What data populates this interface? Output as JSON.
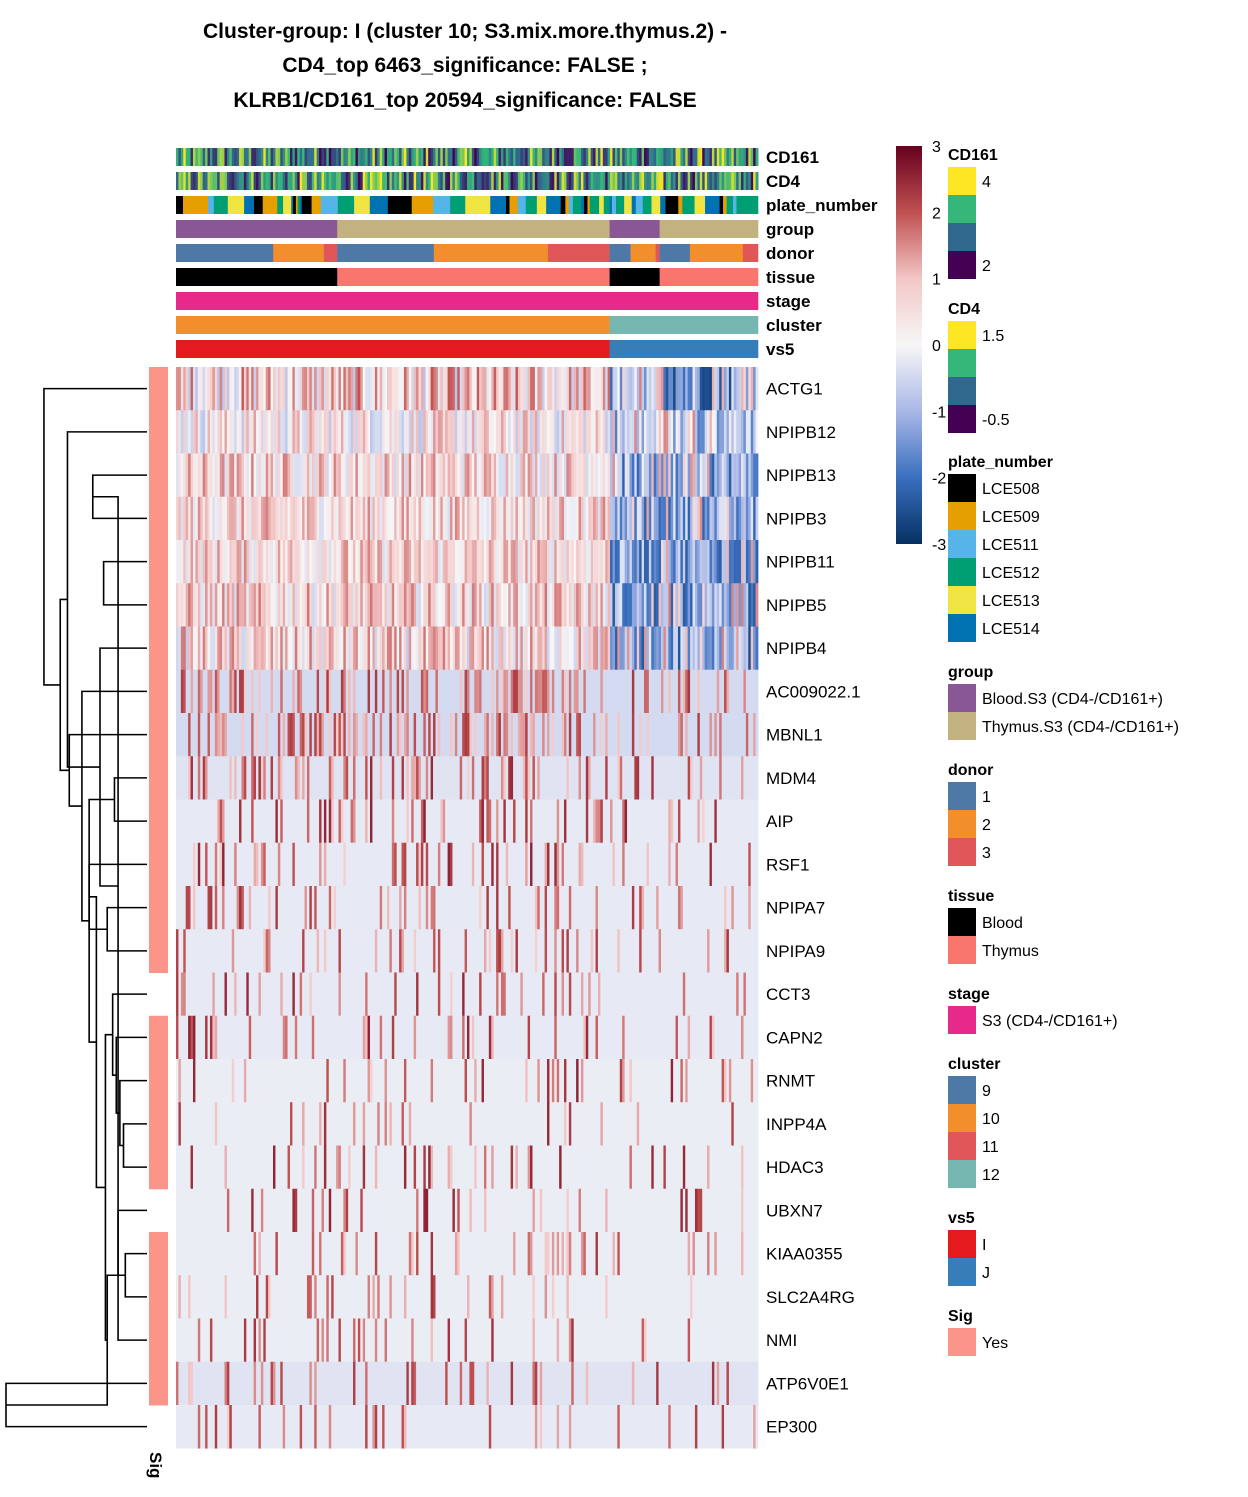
{
  "chart_data": {
    "type": "heatmap",
    "title": [
      "Cluster-group: I (cluster 10; S3.mix.more.thymus.2) -",
      "CD4_top 6463_significance: FALSE ;",
      "KLRB1/CD161_top 20594_significance: FALSE"
    ],
    "color_scale": {
      "range": [
        -3,
        3
      ],
      "ticks": [
        3,
        2,
        1,
        0,
        -1,
        -2,
        -3
      ],
      "tick_labels": [
        "3",
        "2",
        "1",
        "0",
        "-1",
        "-2",
        "-3"
      ],
      "stops": [
        {
          "value": -3,
          "color": "#053061"
        },
        {
          "value": -2,
          "color": "#3a6fbf"
        },
        {
          "value": -1,
          "color": "#a9b7e6"
        },
        {
          "value": 0,
          "color": "#f7f7f7"
        },
        {
          "value": 1,
          "color": "#f3c6c6"
        },
        {
          "value": 2,
          "color": "#c05050"
        },
        {
          "value": 3,
          "color": "#67001f"
        }
      ]
    },
    "n_columns": 240,
    "column_split_fraction": 0.745,
    "column_annotations": [
      {
        "name": "CD161",
        "kind": "continuous",
        "palette": [
          "#440154",
          "#31688e",
          "#35b779",
          "#fde725"
        ],
        "range": [
          2,
          4
        ]
      },
      {
        "name": "CD4",
        "kind": "continuous",
        "palette": [
          "#440154",
          "#31688e",
          "#35b779",
          "#fde725"
        ],
        "range": [
          -0.5,
          1.5
        ]
      },
      {
        "name": "plate_number",
        "kind": "discrete",
        "segments": [
          [
            "LCE508",
            0.0,
            0.012
          ],
          [
            "LCE509",
            0.012,
            0.055
          ],
          [
            "LCE511",
            0.055,
            0.065
          ],
          [
            "LCE512",
            0.065,
            0.089
          ],
          [
            "LCE513",
            0.089,
            0.117
          ],
          [
            "LCE514",
            0.117,
            0.134
          ],
          [
            "LCE508",
            0.134,
            0.149
          ],
          [
            "LCE509",
            0.149,
            0.174
          ],
          [
            "LCE512",
            0.174,
            0.184
          ],
          [
            "LCE513",
            0.184,
            0.198
          ],
          [
            "LCE514",
            0.198,
            0.201
          ],
          [
            "LCE508",
            0.201,
            0.206
          ],
          [
            "LCE509",
            0.206,
            0.209
          ],
          [
            "LCE512",
            0.209,
            0.213
          ],
          [
            "LCE514",
            0.213,
            0.216
          ],
          [
            "LCE508",
            0.216,
            0.233
          ],
          [
            "LCE509",
            0.233,
            0.249
          ],
          [
            "LCE511",
            0.249,
            0.278
          ],
          [
            "LCE512",
            0.278,
            0.306
          ],
          [
            "LCE513",
            0.306,
            0.333
          ],
          [
            "LCE514",
            0.333,
            0.364
          ],
          [
            "LCE508",
            0.364,
            0.405
          ],
          [
            "LCE509",
            0.405,
            0.442
          ],
          [
            "LCE511",
            0.442,
            0.471
          ],
          [
            "LCE512",
            0.471,
            0.497
          ],
          [
            "LCE513",
            0.497,
            0.54
          ],
          [
            "LCE514",
            0.54,
            0.567
          ],
          [
            "LCE508",
            0.567,
            0.573
          ],
          [
            "LCE509",
            0.573,
            0.587
          ],
          [
            "LCE511",
            0.587,
            0.601
          ],
          [
            "LCE512",
            0.601,
            0.62
          ],
          [
            "LCE513",
            0.62,
            0.636
          ],
          [
            "LCE514",
            0.636,
            0.661
          ],
          [
            "LCE508",
            0.661,
            0.669
          ],
          [
            "LCE509",
            0.669,
            0.675
          ],
          [
            "LCE511",
            0.675,
            0.682
          ],
          [
            "LCE512",
            0.682,
            0.696
          ],
          [
            "LCE514",
            0.696,
            0.701
          ],
          [
            "LCE508",
            0.701,
            0.707
          ],
          [
            "LCE509",
            0.707,
            0.711
          ],
          [
            "LCE512",
            0.711,
            0.727
          ],
          [
            "LCE513",
            0.727,
            0.735
          ],
          [
            "LCE512",
            0.735,
            0.745
          ],
          [
            "LCE514",
            0.745,
            0.749
          ],
          [
            "LCE511",
            0.749,
            0.756
          ],
          [
            "LCE512",
            0.756,
            0.77
          ],
          [
            "LCE513",
            0.77,
            0.783
          ],
          [
            "LCE514",
            0.783,
            0.79
          ],
          [
            "LCE511",
            0.79,
            0.802
          ],
          [
            "LCE512",
            0.802,
            0.817
          ],
          [
            "LCE513",
            0.817,
            0.832
          ],
          [
            "LCE514",
            0.832,
            0.841
          ],
          [
            "LCE508",
            0.841,
            0.863
          ],
          [
            "LCE509",
            0.863,
            0.87
          ],
          [
            "LCE512",
            0.87,
            0.891
          ],
          [
            "LCE513",
            0.891,
            0.909
          ],
          [
            "LCE514",
            0.909,
            0.934
          ],
          [
            "LCE508",
            0.934,
            0.94
          ],
          [
            "LCE509",
            0.94,
            0.946
          ],
          [
            "LCE512",
            0.946,
            0.957
          ],
          [
            "LCE511",
            0.957,
            0.963
          ],
          [
            "LCE512",
            0.963,
            1.0
          ]
        ]
      },
      {
        "name": "group",
        "kind": "discrete",
        "segments": [
          [
            "Blood.S3 (CD4-/CD161+)",
            0.0,
            0.277
          ],
          [
            "Thymus.S3 (CD4-/CD161+)",
            0.277,
            0.745
          ],
          [
            "Blood.S3 (CD4-/CD161+)",
            0.745,
            0.831
          ],
          [
            "Thymus.S3 (CD4-/CD161+)",
            0.831,
            1.0
          ]
        ]
      },
      {
        "name": "donor",
        "kind": "discrete",
        "segments": [
          [
            "1",
            0.0,
            0.167
          ],
          [
            "2",
            0.167,
            0.254
          ],
          [
            "3",
            0.254,
            0.277
          ],
          [
            "1",
            0.277,
            0.443
          ],
          [
            "2",
            0.443,
            0.639
          ],
          [
            "3",
            0.639,
            0.745
          ],
          [
            "1",
            0.745,
            0.781
          ],
          [
            "2",
            0.781,
            0.824
          ],
          [
            "3",
            0.824,
            0.831
          ],
          [
            "1",
            0.831,
            0.883
          ],
          [
            "2",
            0.883,
            0.974
          ],
          [
            "3",
            0.974,
            1.0
          ]
        ]
      },
      {
        "name": "tissue",
        "kind": "discrete",
        "segments": [
          [
            "Blood",
            0.0,
            0.277
          ],
          [
            "Thymus",
            0.277,
            0.745
          ],
          [
            "Blood",
            0.745,
            0.831
          ],
          [
            "Thymus",
            0.831,
            1.0
          ]
        ]
      },
      {
        "name": "stage",
        "kind": "discrete",
        "segments": [
          [
            "S3 (CD4-/CD161+)",
            0.0,
            1.0
          ]
        ]
      },
      {
        "name": "cluster",
        "kind": "discrete",
        "segments": [
          [
            "10",
            0.0,
            0.745
          ],
          [
            "12",
            0.745,
            1.0
          ]
        ]
      },
      {
        "name": "vs5",
        "kind": "discrete",
        "segments": [
          [
            "I",
            0.0,
            0.745
          ],
          [
            "J",
            0.745,
            1.0
          ]
        ]
      }
    ],
    "rows": [
      {
        "gene": "ACTG1",
        "sig": "Yes",
        "base_left": 0.6,
        "base_right": -1.3,
        "spread": 1.4,
        "density": 0.9
      },
      {
        "gene": "NPIPB12",
        "sig": "Yes",
        "base_left": 0.3,
        "base_right": -0.7,
        "spread": 1.1,
        "density": 0.7
      },
      {
        "gene": "NPIPB13",
        "sig": "Yes",
        "base_left": 0.6,
        "base_right": -1.2,
        "spread": 1.1,
        "density": 0.85
      },
      {
        "gene": "NPIPB3",
        "sig": "Yes",
        "base_left": 0.6,
        "base_right": -1.2,
        "spread": 1.0,
        "density": 0.85
      },
      {
        "gene": "NPIPB11",
        "sig": "Yes",
        "base_left": 0.6,
        "base_right": -1.3,
        "spread": 1.0,
        "density": 0.85
      },
      {
        "gene": "NPIPB5",
        "sig": "Yes",
        "base_left": 0.6,
        "base_right": -1.3,
        "spread": 1.1,
        "density": 0.85
      },
      {
        "gene": "NPIPB4",
        "sig": "Yes",
        "base_left": 0.5,
        "base_right": -1.4,
        "spread": 1.2,
        "density": 0.85
      },
      {
        "gene": "AC009022.1",
        "sig": "Yes",
        "base_left": -0.45,
        "base_right": -0.45,
        "spread": 1.5,
        "density": 0.45
      },
      {
        "gene": "MBNL1",
        "sig": "Yes",
        "base_left": -0.45,
        "base_right": -0.45,
        "spread": 1.5,
        "density": 0.4
      },
      {
        "gene": "MDM4",
        "sig": "Yes",
        "base_left": -0.3,
        "base_right": -0.3,
        "spread": 1.7,
        "density": 0.3
      },
      {
        "gene": "AIP",
        "sig": "Yes",
        "base_left": -0.2,
        "base_right": -0.2,
        "spread": 1.8,
        "density": 0.2
      },
      {
        "gene": "RSF1",
        "sig": "Yes",
        "base_left": -0.2,
        "base_right": -0.2,
        "spread": 1.8,
        "density": 0.22
      },
      {
        "gene": "NPIPA7",
        "sig": "Yes",
        "base_left": -0.2,
        "base_right": -0.2,
        "spread": 1.6,
        "density": 0.18
      },
      {
        "gene": "NPIPA9",
        "sig": "Yes",
        "base_left": -0.2,
        "base_right": -0.2,
        "spread": 1.6,
        "density": 0.18
      },
      {
        "gene": "CCT3",
        "sig": "",
        "base_left": -0.2,
        "base_right": -0.2,
        "spread": 1.7,
        "density": 0.15
      },
      {
        "gene": "CAPN2",
        "sig": "Yes",
        "base_left": -0.2,
        "base_right": -0.2,
        "spread": 1.8,
        "density": 0.13
      },
      {
        "gene": "RNMT",
        "sig": "Yes",
        "base_left": -0.15,
        "base_right": -0.15,
        "spread": 1.8,
        "density": 0.12
      },
      {
        "gene": "INPP4A",
        "sig": "Yes",
        "base_left": -0.15,
        "base_right": -0.15,
        "spread": 1.8,
        "density": 0.12
      },
      {
        "gene": "HDAC3",
        "sig": "Yes",
        "base_left": -0.15,
        "base_right": -0.15,
        "spread": 1.8,
        "density": 0.12
      },
      {
        "gene": "UBXN7",
        "sig": "",
        "base_left": -0.15,
        "base_right": -0.15,
        "spread": 1.8,
        "density": 0.13
      },
      {
        "gene": "KIAA0355",
        "sig": "Yes",
        "base_left": -0.15,
        "base_right": -0.15,
        "spread": 1.6,
        "density": 0.15
      },
      {
        "gene": "SLC2A4RG",
        "sig": "Yes",
        "base_left": -0.15,
        "base_right": -0.15,
        "spread": 1.6,
        "density": 0.14
      },
      {
        "gene": "NMI",
        "sig": "Yes",
        "base_left": -0.15,
        "base_right": -0.15,
        "spread": 1.6,
        "density": 0.12
      },
      {
        "gene": "ATP6V0E1",
        "sig": "Yes",
        "base_left": -0.3,
        "base_right": -0.3,
        "spread": 1.6,
        "density": 0.2
      },
      {
        "gene": "EP300",
        "sig": "",
        "base_left": -0.2,
        "base_right": -0.2,
        "spread": 1.6,
        "density": 0.16
      }
    ],
    "row_dendrogram": {
      "merges": [
        [
          2,
          3,
          0.3
        ],
        [
          9,
          10,
          0.18
        ],
        [
          12,
          13,
          0.22
        ],
        [
          20,
          21,
          0.12
        ],
        [
          19,
          22,
          0.16
        ],
        [
          4,
          5,
          0.24
        ],
        [
          -1,
          -4,
          0.16
        ],
        [
          -7,
          6,
          0.26
        ],
        [
          -8,
          1,
          0.44
        ],
        [
          23,
          24,
          0.78
        ],
        [
          17,
          18,
          0.13
        ],
        [
          16,
          -11,
          0.15
        ],
        [
          15,
          -12,
          0.17
        ],
        [
          14,
          -13,
          0.19
        ],
        [
          -5,
          -10,
          0.22
        ],
        [
          -14,
          -15,
          0.23
        ],
        [
          11,
          -3,
          0.32
        ],
        [
          -16,
          -17,
          0.28
        ],
        [
          -18,
          -2,
          0.32
        ],
        [
          -19,
          7,
          0.36
        ],
        [
          -20,
          8,
          0.43
        ],
        [
          -21,
          -9,
          0.48
        ],
        [
          -22,
          0,
          0.57
        ]
      ]
    }
  },
  "legends": {
    "CD161": {
      "title": "CD161",
      "labels": [
        "4",
        "2"
      ]
    },
    "CD4": {
      "title": "CD4",
      "labels": [
        "1.5",
        "-0.5"
      ]
    },
    "plate_number": {
      "title": "plate_number",
      "items": [
        {
          "label": "LCE508",
          "color": "#000000"
        },
        {
          "label": "LCE509",
          "color": "#e69f00"
        },
        {
          "label": "LCE511",
          "color": "#56b4e9"
        },
        {
          "label": "LCE512",
          "color": "#009e73"
        },
        {
          "label": "LCE513",
          "color": "#f0e442"
        },
        {
          "label": "LCE514",
          "color": "#0072b2"
        }
      ]
    },
    "group": {
      "title": "group",
      "items": [
        {
          "label": "Blood.S3 (CD4-/CD161+)",
          "color": "#8a5795"
        },
        {
          "label": "Thymus.S3 (CD4-/CD161+)",
          "color": "#c2b280"
        }
      ]
    },
    "donor": {
      "title": "donor",
      "items": [
        {
          "label": "1",
          "color": "#4e79a7"
        },
        {
          "label": "2",
          "color": "#f28e2b"
        },
        {
          "label": "3",
          "color": "#e15759"
        }
      ]
    },
    "tissue": {
      "title": "tissue",
      "items": [
        {
          "label": "Blood",
          "color": "#000000"
        },
        {
          "label": "Thymus",
          "color": "#f8766d"
        }
      ]
    },
    "stage": {
      "title": "stage",
      "items": [
        {
          "label": "S3 (CD4-/CD161+)",
          "color": "#e7298a"
        }
      ]
    },
    "cluster": {
      "title": "cluster",
      "items": [
        {
          "label": "9",
          "color": "#4e79a7"
        },
        {
          "label": "10",
          "color": "#f28e2b"
        },
        {
          "label": "11",
          "color": "#e15759"
        },
        {
          "label": "12",
          "color": "#76b7b2"
        }
      ]
    },
    "vs5": {
      "title": "vs5",
      "items": [
        {
          "label": "I",
          "color": "#e41a1c"
        },
        {
          "label": "J",
          "color": "#377eb8"
        }
      ]
    },
    "Sig": {
      "title": "Sig",
      "items": [
        {
          "label": "Yes",
          "color": "#fb9489"
        }
      ]
    }
  },
  "sig_axis_label": "Sig"
}
